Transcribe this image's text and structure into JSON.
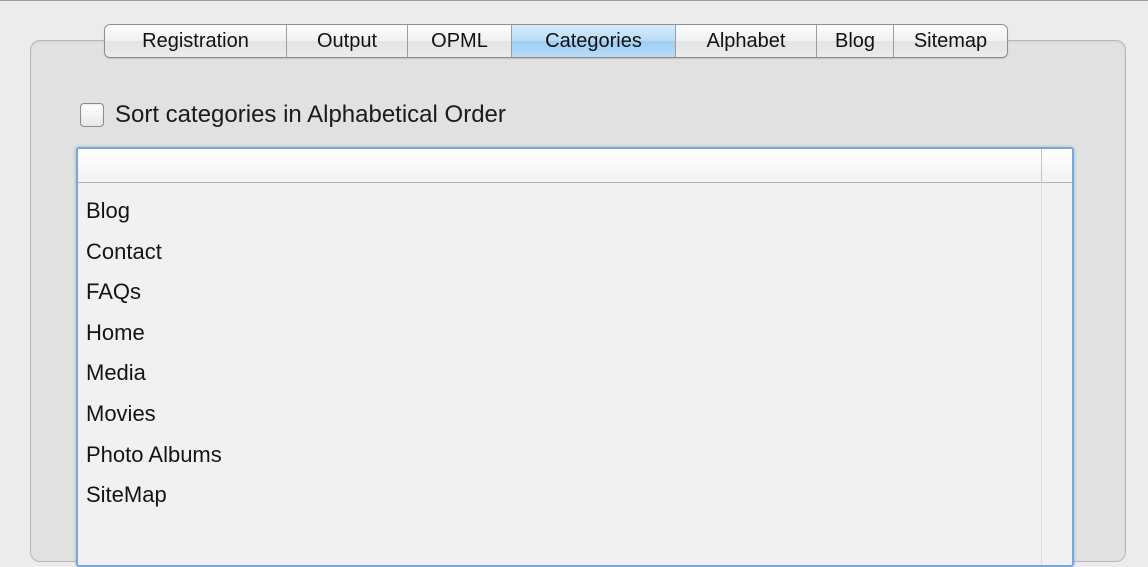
{
  "tabs": [
    {
      "label": "Registration",
      "selected": false
    },
    {
      "label": "Output",
      "selected": false
    },
    {
      "label": "OPML",
      "selected": false
    },
    {
      "label": "Categories",
      "selected": true
    },
    {
      "label": "Alphabet",
      "selected": false
    },
    {
      "label": "Blog",
      "selected": false
    },
    {
      "label": "Sitemap",
      "selected": false
    }
  ],
  "sort_option": {
    "label": "Sort categories in Alphabetical Order",
    "checked": false
  },
  "categories": {
    "header": "",
    "items": [
      "Blog",
      "Contact",
      "FAQs",
      "Home",
      "Media",
      "Movies",
      "Photo Albums",
      "SiteMap"
    ]
  },
  "colors": {
    "selected_tab": "#b7dbf6",
    "focus_ring": "#7ba7d7",
    "panel_background": "#e1e1e1"
  }
}
